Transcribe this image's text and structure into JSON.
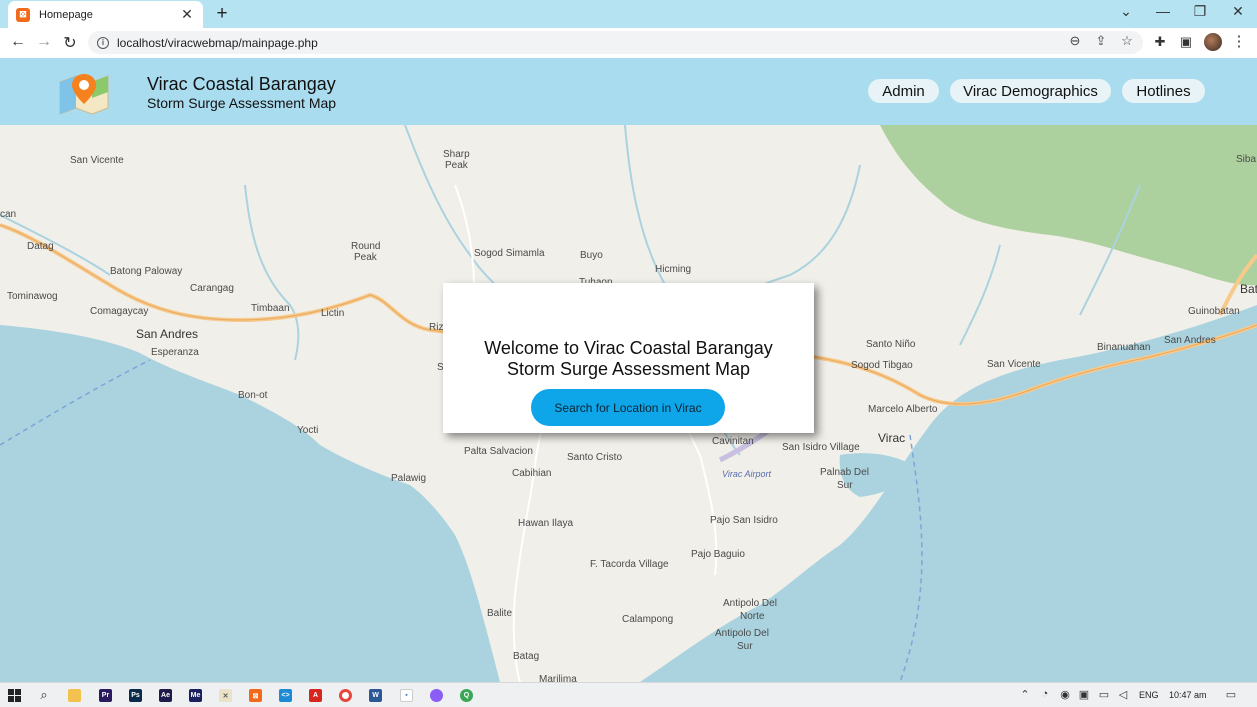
{
  "browser": {
    "tab_title": "Homepage",
    "tab_close": "✕",
    "new_tab": "+",
    "win_minimize": "—",
    "win_restore": "❐",
    "win_close": "✕",
    "win_tabsearch": "⌄",
    "back": "←",
    "forward": "→",
    "reload": "↻",
    "url": "localhost/viracwebmap/mainpage.php",
    "menu": "⋮"
  },
  "site": {
    "title": "Virac Coastal Barangay",
    "subtitle": "Storm Surge Assessment Map",
    "nav": [
      "Admin",
      "Virac Demographics",
      "Hotlines"
    ]
  },
  "modal": {
    "line1": "Welcome to Virac Coastal Barangay",
    "line2": "Storm Surge Assessment Map",
    "button": "Search for Location in Virac"
  },
  "map": {
    "labels": [
      "San Vicente",
      "Sharp",
      "Peak",
      "can",
      "Datag",
      "Round",
      "Peak",
      "Sogod Simamla",
      "Buyo",
      "Hicming",
      "Batong Paloway",
      "Carangag",
      "Tuhaon",
      "Tominawog",
      "Timbaan",
      "Lictin",
      "Comagaycay",
      "San Andres",
      "Esperanza",
      "Riz",
      "S",
      "Bon-ot",
      "Yocti",
      "Palta Salvacion",
      "Santo Cristo",
      "Cabihian",
      "Palawig",
      "Hawan Ilaya",
      "F. Tacorda Village",
      "Pajo Baguio",
      "Balite",
      "Calampong",
      "Batag",
      "Marilima",
      "Santo Niño",
      "Sogod Tibgao",
      "San Vicente",
      "Marcelo Alberto",
      "Virac",
      "Cavinitan",
      "San Isidro Village",
      "Palnab Del",
      "Sur",
      "Virac Airport",
      "Pajo San Isidro",
      "Antipolo Del",
      "Norte",
      "Antipolo Del",
      "Sur",
      "Guinobatan",
      "Binanuahan",
      "San Andres",
      "Siba",
      "Bat"
    ]
  },
  "taskbar": {
    "lang": "ENG",
    "time": "10:47 am"
  },
  "colors": {
    "tabstrip": "#b5e3f1",
    "header": "#a9dcef",
    "land": "#f1efe9",
    "sea": "#aad3df",
    "forest": "#add19e",
    "button": "#0ea5e9"
  }
}
